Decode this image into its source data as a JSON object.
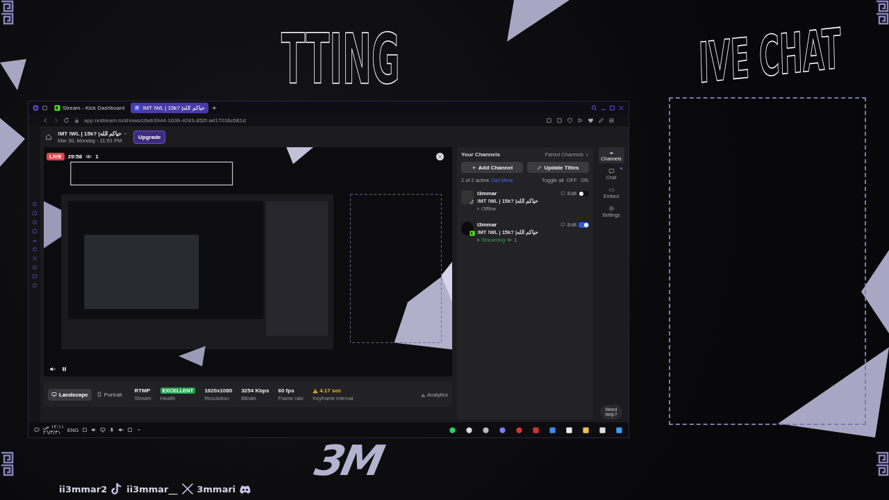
{
  "overlay": {
    "headline_left": "TTING",
    "headline_right": "IVE CHAT",
    "logo": "3M",
    "socials": [
      {
        "handle": "ii3mmar2",
        "kind": "tiktok"
      },
      {
        "handle": "ii3mmar__",
        "kind": "x"
      },
      {
        "handle": "3mmari",
        "kind": "discord"
      }
    ]
  },
  "browser": {
    "tabs": [
      {
        "label": "Stream - Kick Dashboard",
        "selected": false,
        "kind": "kick"
      },
      {
        "label": "!MT !WL | 15k? |حياكم الله",
        "selected": true,
        "kind": "restream"
      }
    ],
    "url": "app.restream.io/shows/c6eb3944-1639-4243-852f-a417016c681d"
  },
  "header": {
    "title": "!MT !WL | 15k? |حياكم الله",
    "subtitle": "Mar 30, Monday · 11:51 PM",
    "upgrade": "Upgrade"
  },
  "preview": {
    "live_badge": "LIVE",
    "timer": "29:58",
    "viewers": "1"
  },
  "stream_bar": {
    "orientations": [
      {
        "label": "Landscape",
        "selected": true
      },
      {
        "label": "Portrait",
        "selected": false
      }
    ],
    "stats": [
      {
        "value": "RTMP",
        "label": "Stream",
        "kind": "plain"
      },
      {
        "value": "EXCELLENT",
        "label": "Health",
        "kind": "badge"
      },
      {
        "value": "1920x1080",
        "label": "Resolution",
        "kind": "plain"
      },
      {
        "value": "3254 Kbps",
        "label": "Bitrate",
        "kind": "plain"
      },
      {
        "value": "60 fps",
        "label": "Frame rate",
        "kind": "plain"
      },
      {
        "value": "4.17 sec",
        "label": "Keyframe interval",
        "kind": "warning"
      }
    ],
    "analytics": "Analytics"
  },
  "channels_panel": {
    "title": "Your Channels",
    "paired": "Paired Channels",
    "add": "Add Channel",
    "update": "Update Titles",
    "active_count": "1 of 2 active",
    "get_more": "Get More",
    "toggle_all": "Toggle all",
    "off": "OFF",
    "on": "ON",
    "channels": [
      {
        "name": "i3mmar",
        "title": "!MT !WL | 15k? |حياكم الله",
        "status": "Offline",
        "kind": "tiktok",
        "edit": "Edit",
        "on": false
      },
      {
        "name": "i3mmar",
        "title": "!MT !WL | 15k? |حياكم الله",
        "status": "Streaming",
        "viewers": "1",
        "kind": "kick",
        "edit": "Edit",
        "on": true
      }
    ]
  },
  "side_rail": {
    "items": [
      {
        "label": "Channels",
        "kind": "channels",
        "selected": true,
        "badge": false
      },
      {
        "label": "Chat",
        "kind": "chat",
        "selected": false,
        "badge": true
      },
      {
        "label": "Embed",
        "kind": "embed",
        "selected": false,
        "badge": false
      },
      {
        "label": "Settings",
        "kind": "settings",
        "selected": false,
        "badge": false
      }
    ],
    "help": "Need help?"
  },
  "taskbar": {
    "time": "١٢:١١ ص",
    "date": "٢٦/٣/٣١",
    "language": "ENG"
  }
}
